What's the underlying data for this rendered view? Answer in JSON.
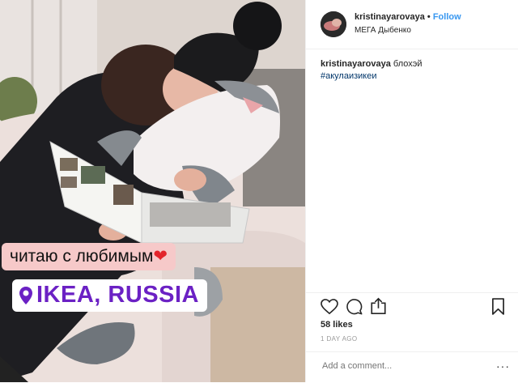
{
  "post": {
    "sticker_text": "читаю с любимым",
    "location_sticker": "IKEA, RUSSIA"
  },
  "header": {
    "username": "kristinayarovaya",
    "separator": "•",
    "follow_label": "Follow",
    "location": "МЕГА Дыбенко"
  },
  "caption": {
    "username": "kristinayarovaya",
    "text": "блохэй",
    "hashtag": "#акулаизикеи"
  },
  "actions": {
    "icons": [
      "heart-icon",
      "comment-icon",
      "share-icon",
      "bookmark-icon"
    ]
  },
  "likes": "58 likes",
  "time_ago": "1 DAY AGO",
  "comment": {
    "placeholder": "Add a comment...",
    "more": "···"
  },
  "colors": {
    "accent": "#3897f0",
    "hashtag": "#003569",
    "location_sticker": "#6b21c4",
    "sticker_bg": "#f6c9c9"
  }
}
